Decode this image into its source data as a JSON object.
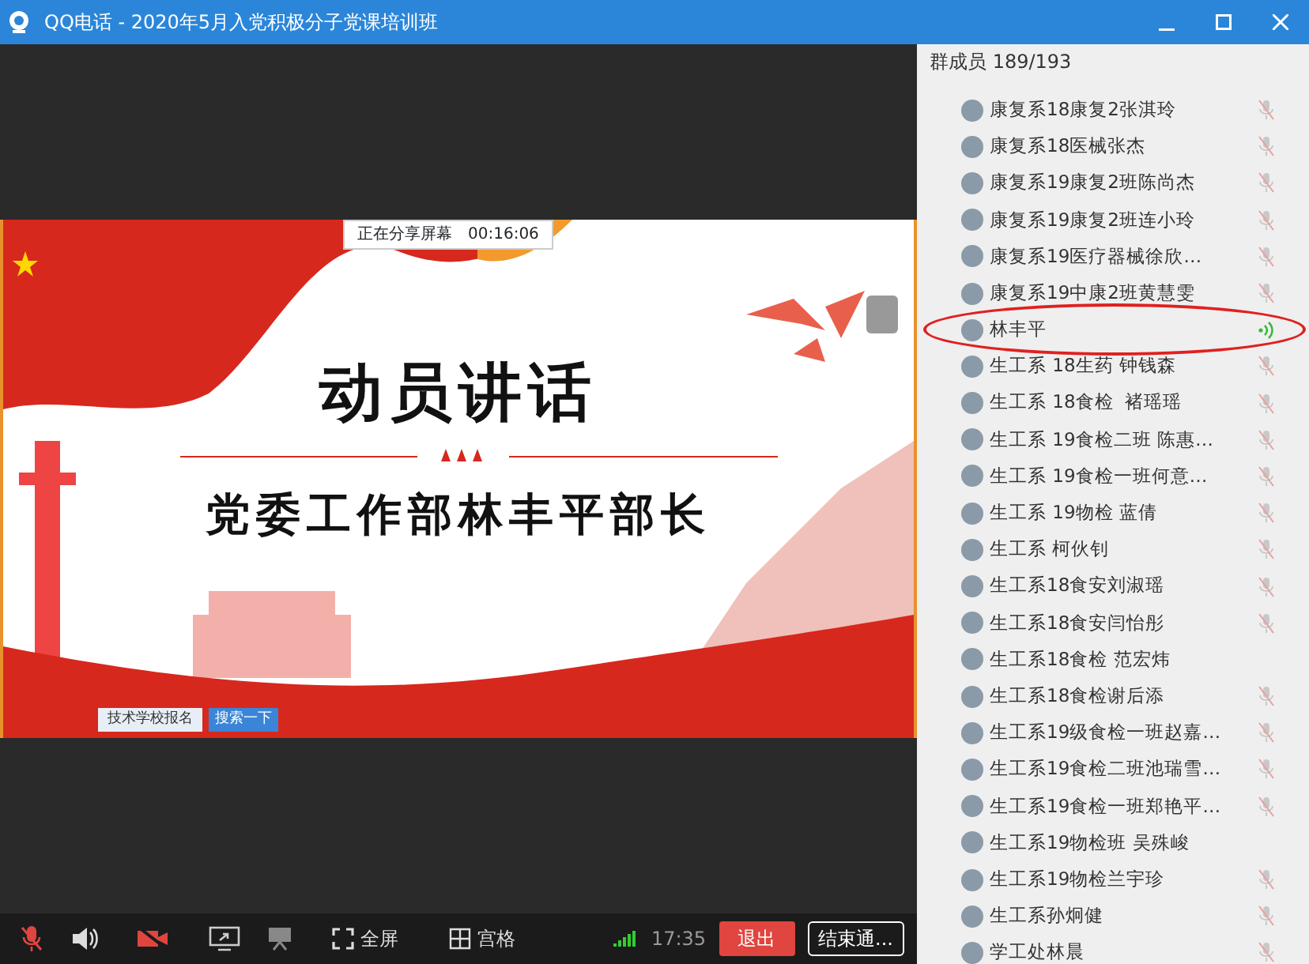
{
  "window": {
    "title": "QQ电话 - 2020年5月入党积极分子党课培训班"
  },
  "shared_screen": {
    "share_bar": {
      "status": "正在分享屏幕",
      "timer": "00:16:06"
    },
    "slide": {
      "title": "动员讲话",
      "subtitle": "党委工作部林丰平部长"
    },
    "taskbar": {
      "search_text": "技术学校报名",
      "search_button": "搜索一下"
    }
  },
  "toolbar": {
    "mic_muted": true,
    "camera_off": true,
    "fullscreen": "全屏",
    "grid": "宫格",
    "time": "17:35",
    "exit": "退出",
    "end_call": "结束通..."
  },
  "members": {
    "header": "群成员 189/193",
    "items": [
      {
        "name": "康复系18康复2张淇玲",
        "muted": true,
        "speaking": false,
        "circled": false
      },
      {
        "name": "康复系18医械张杰",
        "muted": true,
        "speaking": false,
        "circled": false
      },
      {
        "name": "康复系19康复2班陈尚杰",
        "muted": true,
        "speaking": false,
        "circled": false
      },
      {
        "name": "康复系19康复2班连小玲",
        "muted": true,
        "speaking": false,
        "circled": false
      },
      {
        "name": "康复系19医疗器械徐欣…",
        "muted": true,
        "speaking": false,
        "circled": false
      },
      {
        "name": "康复系19中康2班黄慧雯",
        "muted": true,
        "speaking": false,
        "circled": false
      },
      {
        "name": "林丰平",
        "muted": false,
        "speaking": true,
        "circled": true
      },
      {
        "name": "生工系 18生药 钟钱森",
        "muted": true,
        "speaking": false,
        "circled": false
      },
      {
        "name": "生工系 18食检  褚瑶瑶",
        "muted": true,
        "speaking": false,
        "circled": false
      },
      {
        "name": "生工系 19食检二班 陈惠…",
        "muted": true,
        "speaking": false,
        "circled": false
      },
      {
        "name": "生工系 19食检一班何意…",
        "muted": true,
        "speaking": false,
        "circled": false
      },
      {
        "name": "生工系 19物检 蓝倩",
        "muted": true,
        "speaking": false,
        "circled": false
      },
      {
        "name": "生工系 柯伙钊",
        "muted": true,
        "speaking": false,
        "circled": false
      },
      {
        "name": "生工系18食安刘淑瑶",
        "muted": true,
        "speaking": false,
        "circled": false
      },
      {
        "name": "生工系18食安闫怡彤",
        "muted": true,
        "speaking": false,
        "circled": false
      },
      {
        "name": "生工系18食检 范宏炜",
        "muted": false,
        "speaking": false,
        "circled": false
      },
      {
        "name": "生工系18食检谢后添",
        "muted": true,
        "speaking": false,
        "circled": false
      },
      {
        "name": "生工系19级食检一班赵嘉…",
        "muted": true,
        "speaking": false,
        "circled": false
      },
      {
        "name": "生工系19食检二班池瑞雪…",
        "muted": true,
        "speaking": false,
        "circled": false
      },
      {
        "name": "生工系19食检一班郑艳平…",
        "muted": true,
        "speaking": false,
        "circled": false
      },
      {
        "name": "生工系19物检班 吴殊峻",
        "muted": false,
        "speaking": false,
        "circled": false
      },
      {
        "name": "生工系19物检兰宇珍",
        "muted": true,
        "speaking": false,
        "circled": false
      },
      {
        "name": "生工系孙炯健",
        "muted": true,
        "speaking": false,
        "circled": false
      },
      {
        "name": "学工处林晨",
        "muted": true,
        "speaking": false,
        "circled": false
      }
    ]
  }
}
